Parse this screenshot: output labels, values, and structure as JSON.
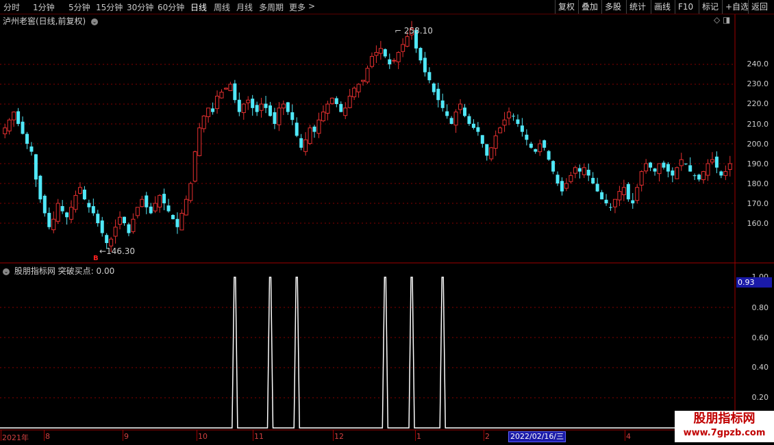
{
  "toolbar": {
    "timeframes": [
      "分时",
      "1分钟",
      "5分钟",
      "15分钟",
      "30分钟",
      "60分钟",
      "日线",
      "周线",
      "月线",
      "多周期",
      "更多"
    ],
    "more_arrow": ">",
    "right_buttons": [
      "复权",
      "叠加",
      "多股",
      "统计",
      "画线",
      "F10",
      "标记",
      "+自选",
      "返回"
    ]
  },
  "chart": {
    "title": "泸州老窖(日线,前复权)",
    "high_label": "258.10",
    "low_label": "146.30",
    "buy_mark": "B",
    "y_ticks": [
      "240.0",
      "230.0",
      "220.0",
      "210.0",
      "200.0",
      "190.0",
      "180.0",
      "170.0",
      "160.0"
    ]
  },
  "indicator": {
    "title": "股朋指标网 突破买点: 0.00",
    "current_value": "0.93",
    "y_ticks": [
      "1.00",
      "0.80",
      "0.60",
      "0.40",
      "0.20"
    ],
    "spike_days": [
      52,
      60,
      66,
      86,
      92,
      99
    ]
  },
  "dates": {
    "labels": [
      {
        "text": "2021年",
        "x": 3
      },
      {
        "text": "8",
        "x": 66
      },
      {
        "text": "9",
        "x": 181
      },
      {
        "text": "10",
        "x": 289
      },
      {
        "text": "11",
        "x": 371
      },
      {
        "text": "12",
        "x": 488
      },
      {
        "text": "1",
        "x": 608
      },
      {
        "text": "2",
        "x": 708
      },
      {
        "text": "4",
        "x": 914
      }
    ],
    "selected": "2022/02/16/三"
  },
  "watermark": {
    "line1": "股朋指标网",
    "line2": "www.7gpzb.com"
  },
  "colors": {
    "up": "#e83030",
    "down": "#50e8f8",
    "grid": "#8a0000",
    "axis": "#a00000",
    "signal": "#ffffff",
    "selected_date_bg": "#1a1aa8"
  },
  "chart_data": {
    "type": "candlestick",
    "ylim": [
      140,
      262
    ],
    "closes": [
      208,
      212,
      216,
      210,
      205,
      200,
      196,
      182,
      172,
      165,
      158,
      162,
      170,
      166,
      163,
      168,
      174,
      178,
      172,
      168,
      165,
      160,
      155,
      150,
      152,
      158,
      163,
      160,
      155,
      162,
      168,
      172,
      168,
      165,
      170,
      174,
      170,
      166,
      162,
      158,
      165,
      172,
      180,
      196,
      208,
      214,
      218,
      216,
      224,
      226,
      228,
      230,
      222,
      216,
      220,
      222,
      218,
      216,
      220,
      218,
      214,
      210,
      218,
      220,
      216,
      212,
      204,
      198,
      202,
      208,
      206,
      212,
      216,
      220,
      223,
      220,
      216,
      218,
      224,
      228,
      230,
      232,
      238,
      244,
      246,
      248,
      244,
      240,
      242,
      246,
      250,
      254,
      258,
      248,
      242,
      236,
      232,
      226,
      222,
      218,
      214,
      210,
      216,
      220,
      214,
      210,
      208,
      206,
      200,
      194,
      198,
      204,
      208,
      212,
      216,
      214,
      210,
      206,
      202,
      198,
      196,
      200,
      198,
      192,
      186,
      180,
      176,
      180,
      184,
      188,
      186,
      188,
      184,
      180,
      176,
      172,
      170,
      168,
      172,
      176,
      178,
      172,
      170,
      178,
      186,
      190,
      188,
      186,
      190,
      188,
      186,
      184,
      188,
      192,
      190,
      186,
      184,
      182,
      186,
      190,
      192,
      188,
      184,
      186,
      190
    ],
    "note": "Daily candlesticks; closes estimated from the 160-240 axis."
  }
}
